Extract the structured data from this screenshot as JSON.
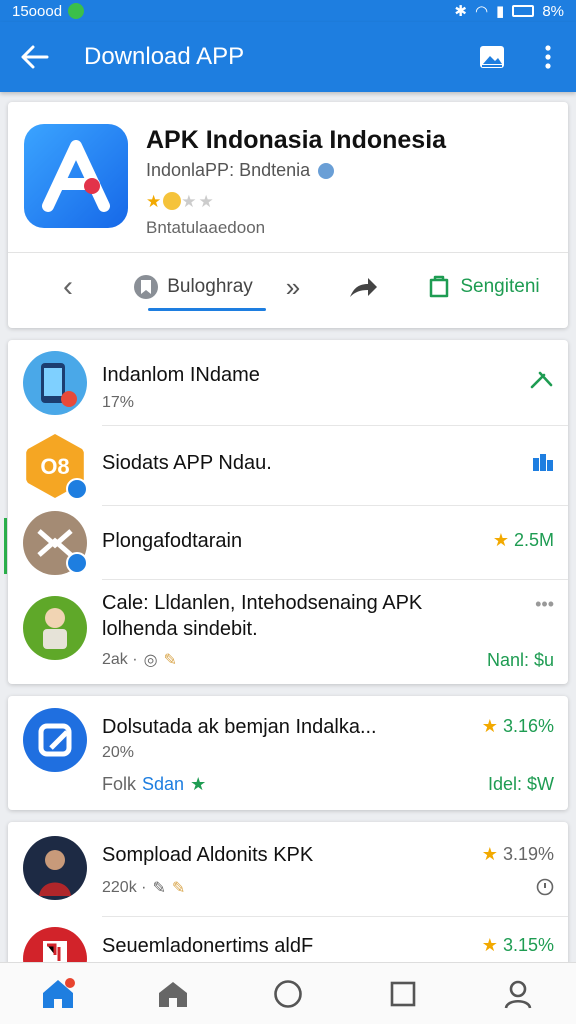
{
  "status_bar": {
    "time": "15оооd",
    "battery": "8%"
  },
  "app_bar": {
    "title": "Download APP"
  },
  "hero": {
    "name": "APK Indonasia Indonesia",
    "subtitle": "IndonlaPP: Bndtenia",
    "rating_stars": 2,
    "rating_total": 5,
    "developer": "Bntatulaaedoon",
    "actions": {
      "bookmark": "Buloghray",
      "signin": "Sengiteni"
    }
  },
  "list1": [
    {
      "title": "Indanlom INdame",
      "sub": "17%",
      "right": ""
    },
    {
      "title": "Siodats APP Ndau.",
      "sub": "",
      "right": ""
    },
    {
      "title": "Plongafodtarain",
      "sub": "",
      "right": "2.5M"
    },
    {
      "title": "Cale: Lldanlen, Intehodsenaing APK",
      "title2": "lolhenda sindebit.",
      "sub": "2ak ·",
      "right": "Nanl: $u"
    }
  ],
  "list2": [
    {
      "title": "Dolsutada ak bemjan Indalka...",
      "sub": "20%",
      "sub2": "Folk",
      "sub2_link": "Sdan",
      "right": "3.16%",
      "right2": "Idel: $W"
    }
  ],
  "list3": [
    {
      "title": "Sompload Aldonits KPK",
      "sub": "220k ·",
      "right": "3.19%"
    },
    {
      "title": "Seuemladonertims aldF",
      "right": "3.15%"
    }
  ],
  "colors": {
    "accent": "#1e7ee0",
    "green": "#1e9c52",
    "star": "#f2a900"
  }
}
